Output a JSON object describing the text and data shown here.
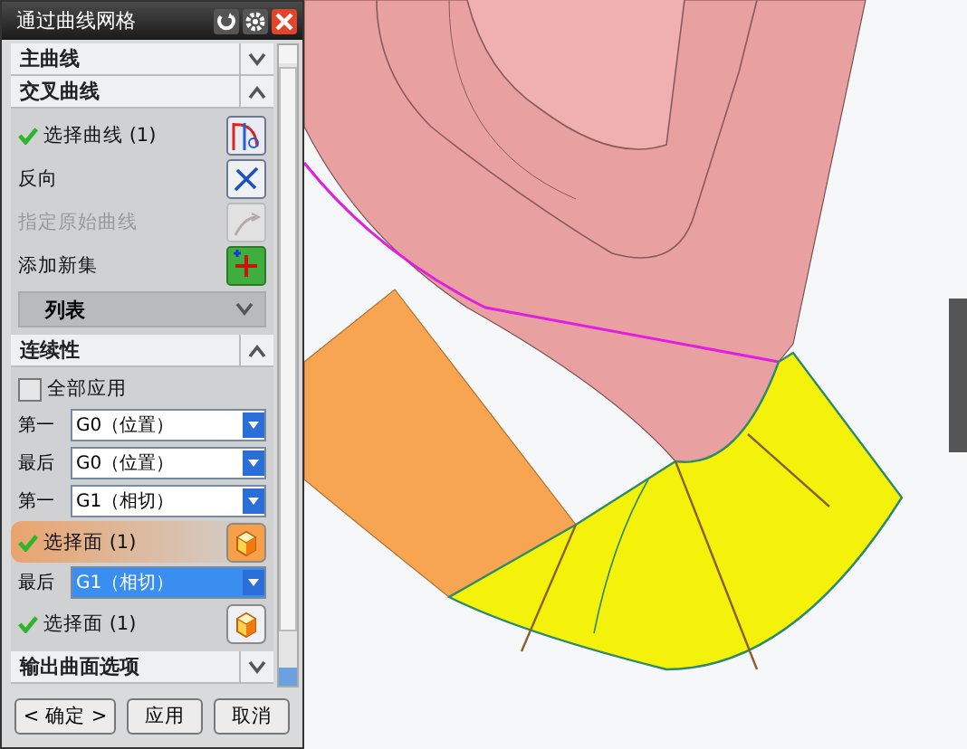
{
  "window": {
    "title": "通过曲线网格"
  },
  "sections": [
    {
      "title": "主曲线",
      "expanded": false
    },
    {
      "title": "交叉曲线",
      "expanded": true,
      "rows": [
        {
          "kind": "selectcurve",
          "label": "选择曲线 (1)",
          "complete": true,
          "selected": false
        },
        {
          "kind": "reverse",
          "label": "反向",
          "disabled": false
        },
        {
          "kind": "origin",
          "label": "指定原始曲线",
          "disabled": true
        },
        {
          "kind": "addset",
          "label": "添加新集",
          "disabled": false
        },
        {
          "kind": "list",
          "label": "列表",
          "expanded": false
        }
      ]
    },
    {
      "title": "连续性",
      "expanded": true,
      "rows": [
        {
          "kind": "checkbox",
          "label": "全部应用",
          "checked": false
        },
        {
          "kind": "combo",
          "label": "第一",
          "value": "G0（位置）",
          "selected": false
        },
        {
          "kind": "combo",
          "label": "最后",
          "value": "G0（位置）",
          "selected": false
        },
        {
          "kind": "combo",
          "label": "第一",
          "value": "G1（相切）",
          "selected": false
        },
        {
          "kind": "selectface",
          "label": "选择面 (1)",
          "complete": true,
          "selected": true
        },
        {
          "kind": "combo",
          "label": "最后",
          "value": "G1（相切）",
          "selected": true
        },
        {
          "kind": "selectface",
          "label": "选择面 (1)",
          "complete": true,
          "selected": false
        }
      ]
    },
    {
      "title": "输出曲面选项",
      "expanded": false
    }
  ],
  "buttons": [
    "< 确定 >",
    "应用",
    "取消"
  ]
}
